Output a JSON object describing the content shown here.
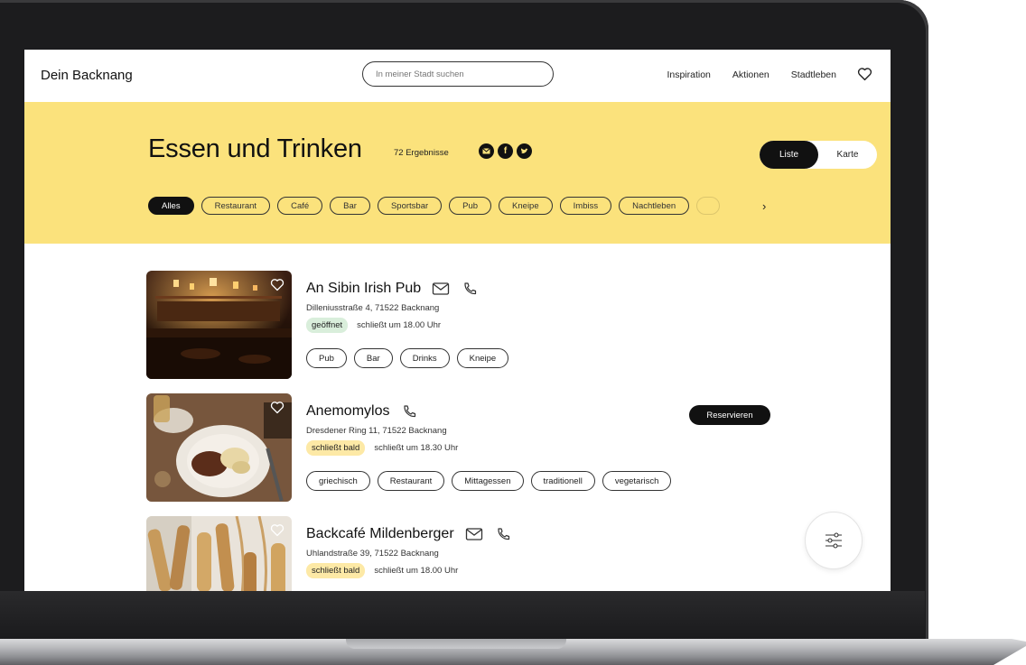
{
  "nav": {
    "brand": "Dein Backnang",
    "search_placeholder": "In meiner Stadt suchen",
    "links": [
      "Inspiration",
      "Aktionen",
      "Stadtleben"
    ]
  },
  "hero": {
    "title": "Essen und Trinken",
    "count": "72 Ergebnisse",
    "social_icons": [
      "mail-icon",
      "facebook-icon",
      "twitter-icon"
    ],
    "view_toggle": {
      "list": "Liste",
      "map": "Karte",
      "active": "Liste"
    },
    "filters": [
      "Alles",
      "Restaurant",
      "Café",
      "Bar",
      "Sportsbar",
      "Pub",
      "Kneipe",
      "Imbiss",
      "Nachtleben"
    ],
    "active_filter": "Alles"
  },
  "listings": [
    {
      "name": "An Sibin Irish Pub",
      "address": "Dilleniusstraße 4, 71522 Backnang",
      "status": "geöffnet",
      "hours": "schließt um 18.00 Uhr",
      "tags": [
        "Pub",
        "Bar",
        "Drinks",
        "Kneipe"
      ]
    },
    {
      "name": "Anemomylos",
      "address": "Dresdener Ring 11, 71522 Backnang",
      "status": "schließt bald",
      "hours": "schließt um 18.30 Uhr",
      "tags": [
        "griechisch",
        "Restaurant",
        "Mittagessen",
        "traditionell",
        "vegetarisch"
      ],
      "reserve_label": "Reservieren"
    },
    {
      "name": "Backcafé Mildenberger",
      "address": "Uhlandstraße 39, 71522 Backnang",
      "status": "schließt bald",
      "hours": "schließt um 18.00 Uhr",
      "tags": []
    }
  ],
  "colors": {
    "hero_bg": "#fbe27c",
    "open_badge": "#d9eedb",
    "soon_badge": "#fde9a6",
    "dark": "#111111"
  }
}
